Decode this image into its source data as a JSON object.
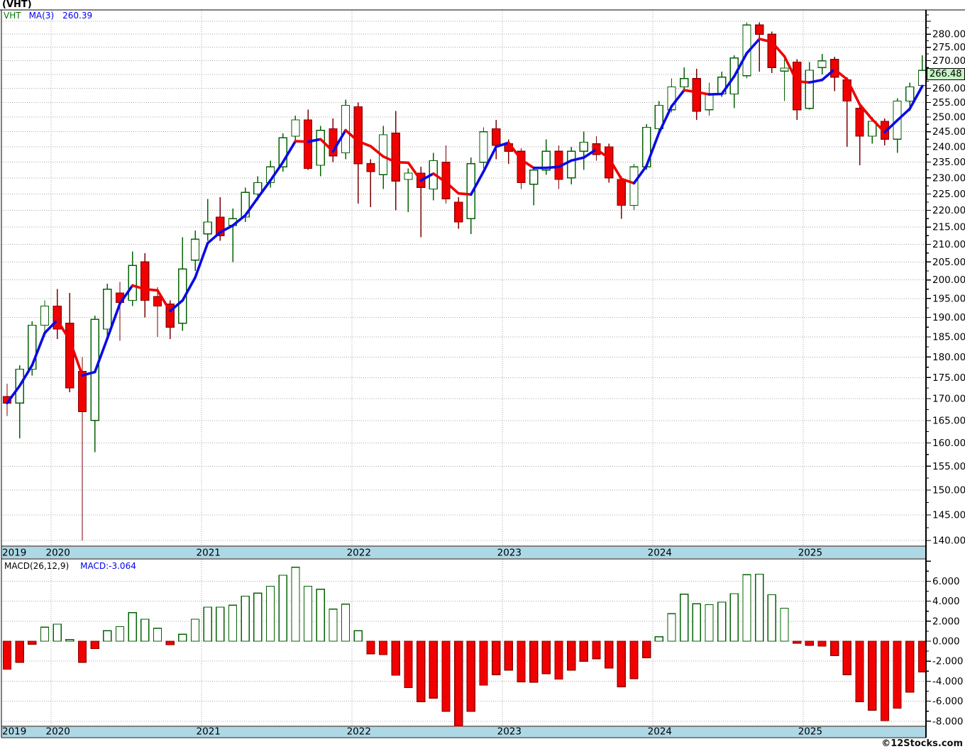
{
  "header": {
    "title": "(VHT)"
  },
  "price_pane": {
    "legend": {
      "symbol": "VHT",
      "ma_label": "MA(3)",
      "ma_value": "260.39"
    },
    "badge": "266.48",
    "axis_labels": [
      "280.00",
      "275.00",
      "270.00",
      "260.00",
      "255.00",
      "250.00",
      "245.00",
      "240.00",
      "235.00",
      "230.00",
      "225.00",
      "220.00",
      "215.00",
      "210.00",
      "205.00",
      "200.00",
      "195.00",
      "190.00",
      "185.00",
      "180.00",
      "175.00",
      "170.00",
      "165.00",
      "160.00",
      "155.00",
      "150.00",
      "145.00",
      "140.00"
    ]
  },
  "macd_pane": {
    "legend": {
      "name": "MACD(26,12,9)",
      "value": "MACD:-3.064"
    },
    "axis_labels": [
      "6.000",
      "4.000",
      "2.000",
      "0.000",
      "-2.000",
      "-4.000",
      "-6.000",
      "-8.000"
    ]
  },
  "x_axis": {
    "years": [
      "2019",
      "2020",
      "2021",
      "2022",
      "2023",
      "2024",
      "2025"
    ]
  },
  "footer": {
    "copyright": "©12Stocks.com"
  },
  "colors": {
    "up_stroke": "#046104",
    "up_fill": "#FFFFFF",
    "down_fill": "#F20000",
    "down_stroke": "#8F0000",
    "down_wick": "#7A0000",
    "ma_up": "#0A0AE6",
    "ma_down": "#EE0000",
    "grid": "#A9A9A9",
    "band": "#ADD8E6",
    "border": "#000000",
    "badge_bg": "#C6F2C6",
    "legend_symbol": "#067806",
    "legend_value": "#0000EE",
    "text": "#000000"
  },
  "chart_data": [
    {
      "type": "candlestick",
      "title": "(VHT)",
      "symbol": "VHT",
      "overlay": "MA(3) colored blue when rising, red when falling",
      "ma_last": 260.39,
      "last_price": 266.48,
      "ylim": [
        140,
        289
      ],
      "yscale": "log",
      "ytick_step": 5,
      "months": [
        "2019-09",
        "2019-10",
        "2019-11",
        "2019-12",
        "2020-01",
        "2020-02",
        "2020-03",
        "2020-04",
        "2020-05",
        "2020-06",
        "2020-07",
        "2020-08",
        "2020-09",
        "2020-10",
        "2020-11",
        "2020-12",
        "2021-01",
        "2021-02",
        "2021-03",
        "2021-04",
        "2021-05",
        "2021-06",
        "2021-07",
        "2021-08",
        "2021-09",
        "2021-10",
        "2021-11",
        "2021-12",
        "2022-01",
        "2022-02",
        "2022-03",
        "2022-04",
        "2022-05",
        "2022-06",
        "2022-07",
        "2022-08",
        "2022-09",
        "2022-10",
        "2022-11",
        "2022-12",
        "2023-01",
        "2023-02",
        "2023-03",
        "2023-04",
        "2023-05",
        "2023-06",
        "2023-07",
        "2023-08",
        "2023-09",
        "2023-10",
        "2023-11",
        "2023-12",
        "2024-01",
        "2024-02",
        "2024-03",
        "2024-04",
        "2024-05",
        "2024-06",
        "2024-07",
        "2024-08",
        "2024-09",
        "2024-10",
        "2024-11",
        "2024-12",
        "2025-01",
        "2025-02",
        "2025-03",
        "2025-04",
        "2025-05",
        "2025-06",
        "2025-07",
        "2025-08",
        "2025-09",
        "2025-10"
      ],
      "ohlc": [
        [
          170.5,
          173.5,
          166,
          169
        ],
        [
          169,
          178,
          161,
          177
        ],
        [
          177,
          189,
          175.5,
          188
        ],
        [
          188,
          194.5,
          185,
          193
        ],
        [
          193,
          197.5,
          184.5,
          187
        ],
        [
          188.5,
          196.5,
          171.5,
          172.5
        ],
        [
          176.5,
          180,
          140,
          167
        ],
        [
          165,
          190.5,
          158,
          189.5
        ],
        [
          187,
          199,
          184.5,
          197.5
        ],
        [
          196.5,
          199.5,
          184,
          194
        ],
        [
          194.5,
          208,
          193,
          204
        ],
        [
          205,
          207.5,
          190,
          194.5
        ],
        [
          195.5,
          198,
          185,
          193
        ],
        [
          193.5,
          194.5,
          184.5,
          187.5
        ],
        [
          188.5,
          212,
          186.5,
          203
        ],
        [
          205.5,
          214,
          202.5,
          211.5
        ],
        [
          213,
          223.5,
          211,
          216.5
        ],
        [
          218,
          224,
          211,
          212.5
        ],
        [
          215.5,
          220.5,
          205,
          217.5
        ],
        [
          218,
          227,
          216.5,
          225.5
        ],
        [
          225,
          230.5,
          223,
          228.5
        ],
        [
          228.5,
          235.5,
          227,
          233.5
        ],
        [
          233.5,
          244.5,
          232,
          243
        ],
        [
          243.5,
          250.5,
          242,
          249
        ],
        [
          249,
          252.5,
          232.5,
          233
        ],
        [
          234,
          247,
          230.5,
          245.5
        ],
        [
          246,
          249.5,
          235,
          237
        ],
        [
          238,
          256,
          236,
          254
        ],
        [
          253.5,
          255,
          222,
          234.5
        ],
        [
          234.5,
          236,
          221,
          232
        ],
        [
          231,
          247,
          226.5,
          244
        ],
        [
          244.5,
          252,
          220,
          229
        ],
        [
          229.5,
          233,
          219.5,
          231.5
        ],
        [
          231.5,
          233.5,
          212,
          227
        ],
        [
          226.5,
          238,
          223,
          235.5
        ],
        [
          235,
          240.5,
          222,
          223.5
        ],
        [
          222.5,
          224,
          214.5,
          216.5
        ],
        [
          217.5,
          236.5,
          213,
          234.5
        ],
        [
          235,
          246.5,
          233,
          245
        ],
        [
          246,
          249,
          236,
          240.5
        ],
        [
          241,
          242.5,
          234.5,
          238.5
        ],
        [
          238.5,
          239.5,
          226.5,
          228.5
        ],
        [
          228,
          233.5,
          221.5,
          232.5
        ],
        [
          232.5,
          242.5,
          231,
          238.5
        ],
        [
          238.5,
          240.5,
          226.5,
          229.5
        ],
        [
          230,
          240,
          228,
          238.5
        ],
        [
          238.5,
          245,
          232.5,
          241.5
        ],
        [
          241,
          243.5,
          235.5,
          237.5
        ],
        [
          240,
          241,
          228.5,
          230
        ],
        [
          229.5,
          230.5,
          217.5,
          221.5
        ],
        [
          221.5,
          234.5,
          220,
          233.5
        ],
        [
          233.5,
          247.5,
          232.5,
          246.5
        ],
        [
          246,
          255.5,
          244.5,
          254
        ],
        [
          252.5,
          263.5,
          251.5,
          260.5
        ],
        [
          260.5,
          267.5,
          259,
          263.5
        ],
        [
          263.5,
          267,
          249,
          252
        ],
        [
          252.5,
          262,
          250.5,
          258
        ],
        [
          258,
          266,
          257,
          264
        ],
        [
          258,
          272,
          253,
          271
        ],
        [
          264.5,
          284.5,
          263.5,
          283.5
        ],
        [
          283.5,
          284.5,
          266,
          280
        ],
        [
          280,
          281,
          265.5,
          267.5
        ],
        [
          266.2,
          270.5,
          255.5,
          267.3
        ],
        [
          269.5,
          270.5,
          249,
          252.5
        ],
        [
          253,
          269.5,
          252.5,
          266.5
        ],
        [
          267.5,
          272.5,
          265,
          270
        ],
        [
          270.5,
          271.5,
          259,
          264
        ],
        [
          263,
          264,
          240,
          255.5
        ],
        [
          253,
          254,
          234,
          243.5
        ],
        [
          243.5,
          250,
          241,
          248.5
        ],
        [
          248.5,
          249.5,
          240.5,
          242.5
        ],
        [
          242.5,
          256.5,
          238,
          255.5
        ],
        [
          255.5,
          262,
          252,
          260.5
        ],
        [
          261,
          272,
          260,
          266.48
        ]
      ]
    },
    {
      "type": "bar",
      "name": "MACD(26,12,9)",
      "last_value": -3.064,
      "ylim": [
        -8.5,
        8.2
      ],
      "ytick_step": 2,
      "values": [
        -2.8,
        -2.1,
        -0.3,
        1.4,
        1.7,
        0.15,
        -2.1,
        -0.75,
        1.05,
        1.45,
        2.85,
        2.2,
        1.3,
        -0.35,
        0.7,
        2.2,
        3.4,
        3.4,
        3.6,
        4.5,
        4.8,
        5.5,
        6.6,
        7.4,
        5.5,
        5.2,
        3.2,
        3.7,
        1.05,
        -1.25,
        -1.35,
        -3.4,
        -4.65,
        -6.05,
        -5.7,
        -7.0,
        -8.5,
        -7.0,
        -4.4,
        -3.35,
        -2.9,
        -4.05,
        -4.1,
        -3.25,
        -3.8,
        -2.9,
        -2.0,
        -1.75,
        -2.7,
        -4.55,
        -3.75,
        -1.65,
        0.45,
        2.75,
        4.7,
        3.75,
        3.65,
        3.9,
        4.75,
        6.65,
        6.7,
        4.65,
        3.3,
        -0.2,
        -0.4,
        -0.5,
        -1.45,
        -3.35,
        -6.05,
        -6.9,
        -7.95,
        -6.7,
        -5.1,
        -3.064
      ]
    }
  ]
}
